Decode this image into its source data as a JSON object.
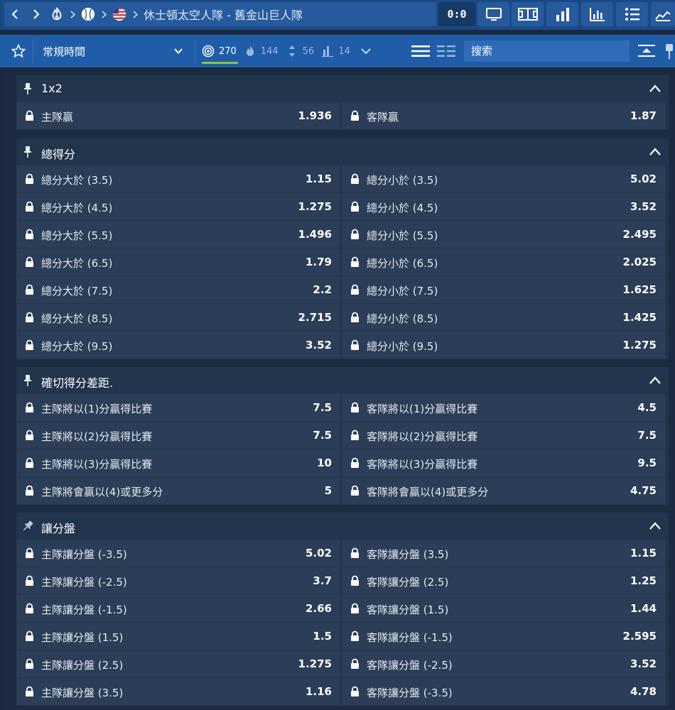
{
  "header": {
    "event_title": "休士頓太空人隊 - 舊金山巨人隊",
    "score": "0:0",
    "icons": [
      "back-icon",
      "forward-icon",
      "hot-fire-icon",
      "baseball-icon",
      "usa-flag-icon",
      "tv-icon",
      "field-icon",
      "stats-bars-icon",
      "chart-icon",
      "list-icon",
      "lineup-icon"
    ]
  },
  "toolbar": {
    "period_label": "常規時間",
    "filters": [
      {
        "count": "270",
        "icon": "all-markets-icon"
      },
      {
        "count": "144",
        "icon": "fire-icon"
      },
      {
        "count": "56",
        "icon": "updown-icon"
      },
      {
        "count": "14",
        "icon": "bars-icon"
      }
    ],
    "search_placeholder": "搜索"
  },
  "colors": {
    "topbar": "#1a4a86",
    "toolbar": "#1f5da8",
    "panel": "#23344d",
    "cell": "#2b3d57",
    "active_underline": "#8dc63f"
  },
  "markets": [
    {
      "title": "1x2",
      "rows": [
        [
          {
            "label": "主隊贏",
            "odds": "1.936"
          },
          {
            "label": "客隊贏",
            "odds": "1.87"
          }
        ]
      ]
    },
    {
      "title": "總得分",
      "rows": [
        [
          {
            "label": "總分大於 (3.5)",
            "odds": "1.15"
          },
          {
            "label": "總分小於 (3.5)",
            "odds": "5.02"
          }
        ],
        [
          {
            "label": "總分大於 (4.5)",
            "odds": "1.275"
          },
          {
            "label": "總分小於 (4.5)",
            "odds": "3.52"
          }
        ],
        [
          {
            "label": "總分大於 (5.5)",
            "odds": "1.496"
          },
          {
            "label": "總分小於 (5.5)",
            "odds": "2.495"
          }
        ],
        [
          {
            "label": "總分大於 (6.5)",
            "odds": "1.79"
          },
          {
            "label": "總分小於 (6.5)",
            "odds": "2.025"
          }
        ],
        [
          {
            "label": "總分大於 (7.5)",
            "odds": "2.2"
          },
          {
            "label": "總分小於 (7.5)",
            "odds": "1.625"
          }
        ],
        [
          {
            "label": "總分大於 (8.5)",
            "odds": "2.715"
          },
          {
            "label": "總分小於 (8.5)",
            "odds": "1.425"
          }
        ],
        [
          {
            "label": "總分大於 (9.5)",
            "odds": "3.52"
          },
          {
            "label": "總分小於 (9.5)",
            "odds": "1.275"
          }
        ]
      ]
    },
    {
      "title": "確切得分差距.",
      "rows": [
        [
          {
            "label": "主隊將以(1)分贏得比賽",
            "odds": "7.5"
          },
          {
            "label": "客隊將以(1)分贏得比賽",
            "odds": "4.5"
          }
        ],
        [
          {
            "label": "主隊將以(2)分贏得比賽",
            "odds": "7.5"
          },
          {
            "label": "客隊將以(2)分贏得比賽",
            "odds": "7.5"
          }
        ],
        [
          {
            "label": "主隊將以(3)分贏得比賽",
            "odds": "10"
          },
          {
            "label": "客隊將以(3)分贏得比賽",
            "odds": "9.5"
          }
        ],
        [
          {
            "label": "主隊將會贏以(4)或更多分",
            "odds": "5"
          },
          {
            "label": "客隊將會贏以(4)或更多分",
            "odds": "4.75"
          }
        ]
      ]
    },
    {
      "title": "讓分盤",
      "rows": [
        [
          {
            "label": "主隊讓分盤 (-3.5)",
            "odds": "5.02"
          },
          {
            "label": "客隊讓分盤 (3.5)",
            "odds": "1.15"
          }
        ],
        [
          {
            "label": "主隊讓分盤 (-2.5)",
            "odds": "3.7"
          },
          {
            "label": "客隊讓分盤 (2.5)",
            "odds": "1.25"
          }
        ],
        [
          {
            "label": "主隊讓分盤 (-1.5)",
            "odds": "2.66"
          },
          {
            "label": "客隊讓分盤 (1.5)",
            "odds": "1.44"
          }
        ],
        [
          {
            "label": "主隊讓分盤 (1.5)",
            "odds": "1.5"
          },
          {
            "label": "客隊讓分盤 (-1.5)",
            "odds": "2.595"
          }
        ],
        [
          {
            "label": "主隊讓分盤 (2.5)",
            "odds": "1.275"
          },
          {
            "label": "客隊讓分盤 (-2.5)",
            "odds": "3.52"
          }
        ],
        [
          {
            "label": "主隊讓分盤 (3.5)",
            "odds": "1.16"
          },
          {
            "label": "客隊讓分盤 (-3.5)",
            "odds": "4.78"
          }
        ]
      ]
    }
  ]
}
